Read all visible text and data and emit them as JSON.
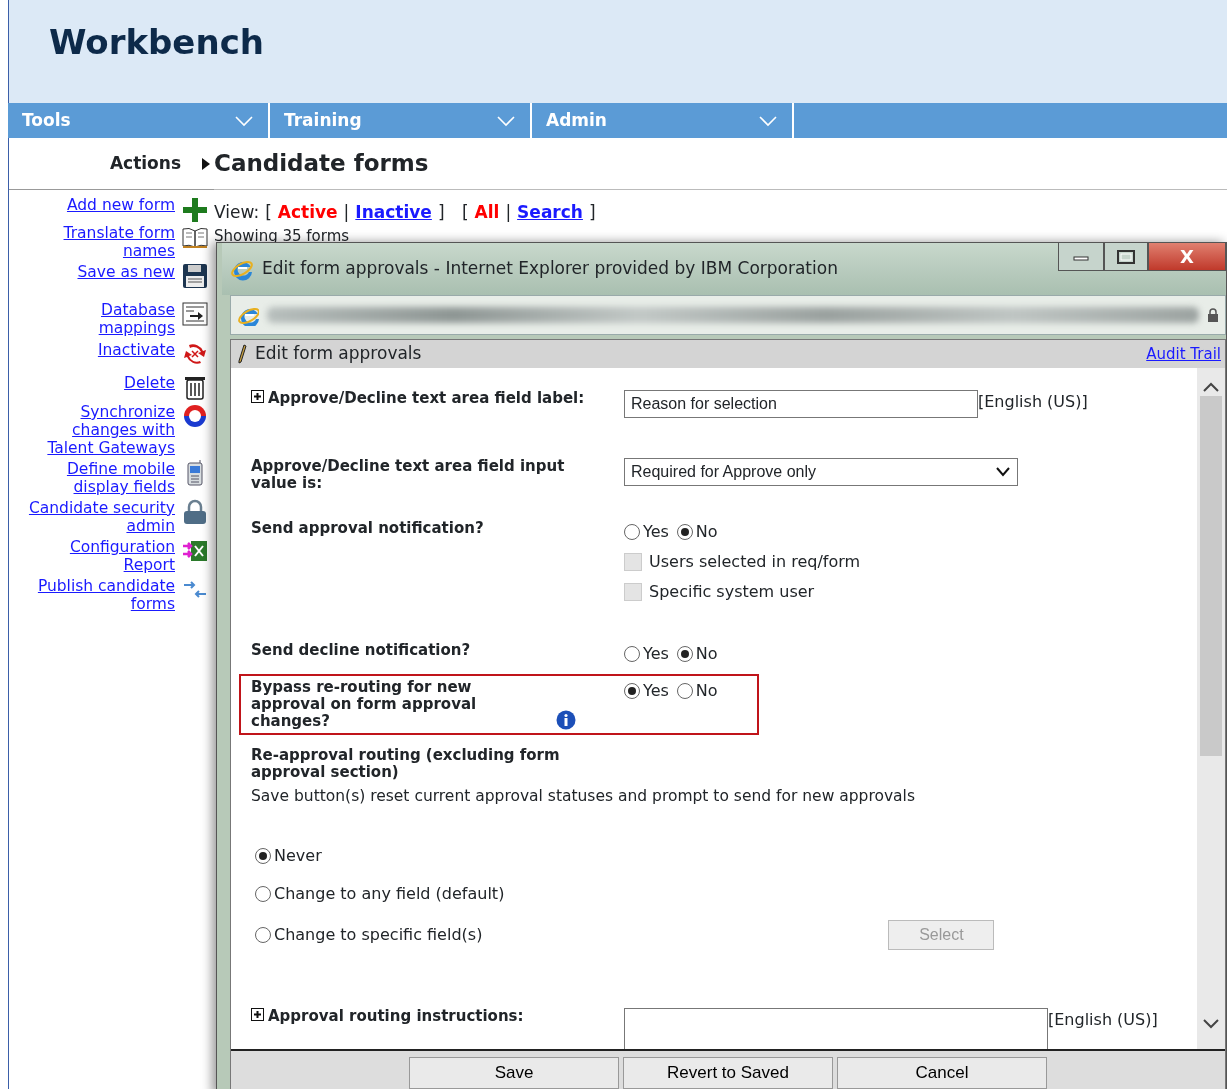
{
  "header": {
    "title": "Workbench"
  },
  "menu": [
    {
      "label": "Tools"
    },
    {
      "label": "Training"
    },
    {
      "label": "Admin"
    }
  ],
  "sidebar": {
    "heading": "Actions",
    "items": [
      {
        "label": "Add new form"
      },
      {
        "label": "Translate form names"
      },
      {
        "label": "Save as new"
      },
      {
        "label": "Database mappings"
      },
      {
        "label": "Inactivate"
      },
      {
        "label": "Delete"
      },
      {
        "label": "Synchronize changes with Talent Gateways"
      },
      {
        "label": "Define mobile display fields"
      },
      {
        "label": "Candidate security admin"
      },
      {
        "label": "Configuration Report"
      },
      {
        "label": "Publish candidate forms"
      }
    ]
  },
  "page": {
    "title": "Candidate forms",
    "view_label": "View:",
    "open": "[",
    "close": "]",
    "separator": "|",
    "filter_groups": [
      [
        {
          "label": "Active",
          "selected": true
        },
        {
          "label": "Inactive",
          "selected": false
        }
      ],
      [
        {
          "label": "All",
          "selected": true
        },
        {
          "label": "Search",
          "selected": false
        }
      ]
    ],
    "count": "Showing 35 forms"
  },
  "popup": {
    "title": "Edit form approvals - Internet Explorer provided by IBM Corporation",
    "close_label": "X",
    "panel_title": "Edit form approvals",
    "audit_link": "Audit Trail",
    "fields": [
      {
        "kind": "text",
        "label": "Approve/Decline text area field label:",
        "expandable": true,
        "value": "Reason for selection",
        "suffix": "[English (US)]"
      },
      {
        "kind": "select",
        "label": "Approve/Decline text area field input value is:",
        "value": "Required for Approve only"
      },
      {
        "kind": "radio",
        "label": "Send approval notification?",
        "options": [
          {
            "label": "Yes",
            "selected": false
          },
          {
            "label": "No",
            "selected": true
          }
        ],
        "checks": [
          {
            "label": "Users selected in req/form",
            "checked": false,
            "disabled": true
          },
          {
            "label": "Specific system user",
            "checked": false,
            "disabled": true
          }
        ]
      },
      {
        "kind": "radio",
        "label": "Send decline notification?",
        "options": [
          {
            "label": "Yes",
            "selected": false
          },
          {
            "label": "No",
            "selected": true
          }
        ]
      },
      {
        "kind": "radio",
        "label": "Bypass re-routing for new approval on form approval changes?",
        "highlighted": true,
        "info": true,
        "options": [
          {
            "label": "Yes",
            "selected": true
          },
          {
            "label": "No",
            "selected": false
          }
        ]
      },
      {
        "kind": "section",
        "label": "Re-approval routing (excluding form approval section)",
        "description": "Save button(s) reset current approval statuses and prompt to send for new approvals",
        "options": [
          {
            "label": "Never",
            "selected": true
          },
          {
            "label": "Change to any field (default)",
            "selected": false
          },
          {
            "label": "Change to specific field(s)",
            "selected": false
          }
        ],
        "button": {
          "label": "Select",
          "disabled": true
        }
      },
      {
        "kind": "textarea",
        "label": "Approval routing instructions:",
        "expandable": true,
        "suffix": "[English (US)]"
      }
    ],
    "buttons": [
      {
        "label": "Save"
      },
      {
        "label": "Revert to Saved"
      },
      {
        "label": "Cancel"
      }
    ]
  }
}
